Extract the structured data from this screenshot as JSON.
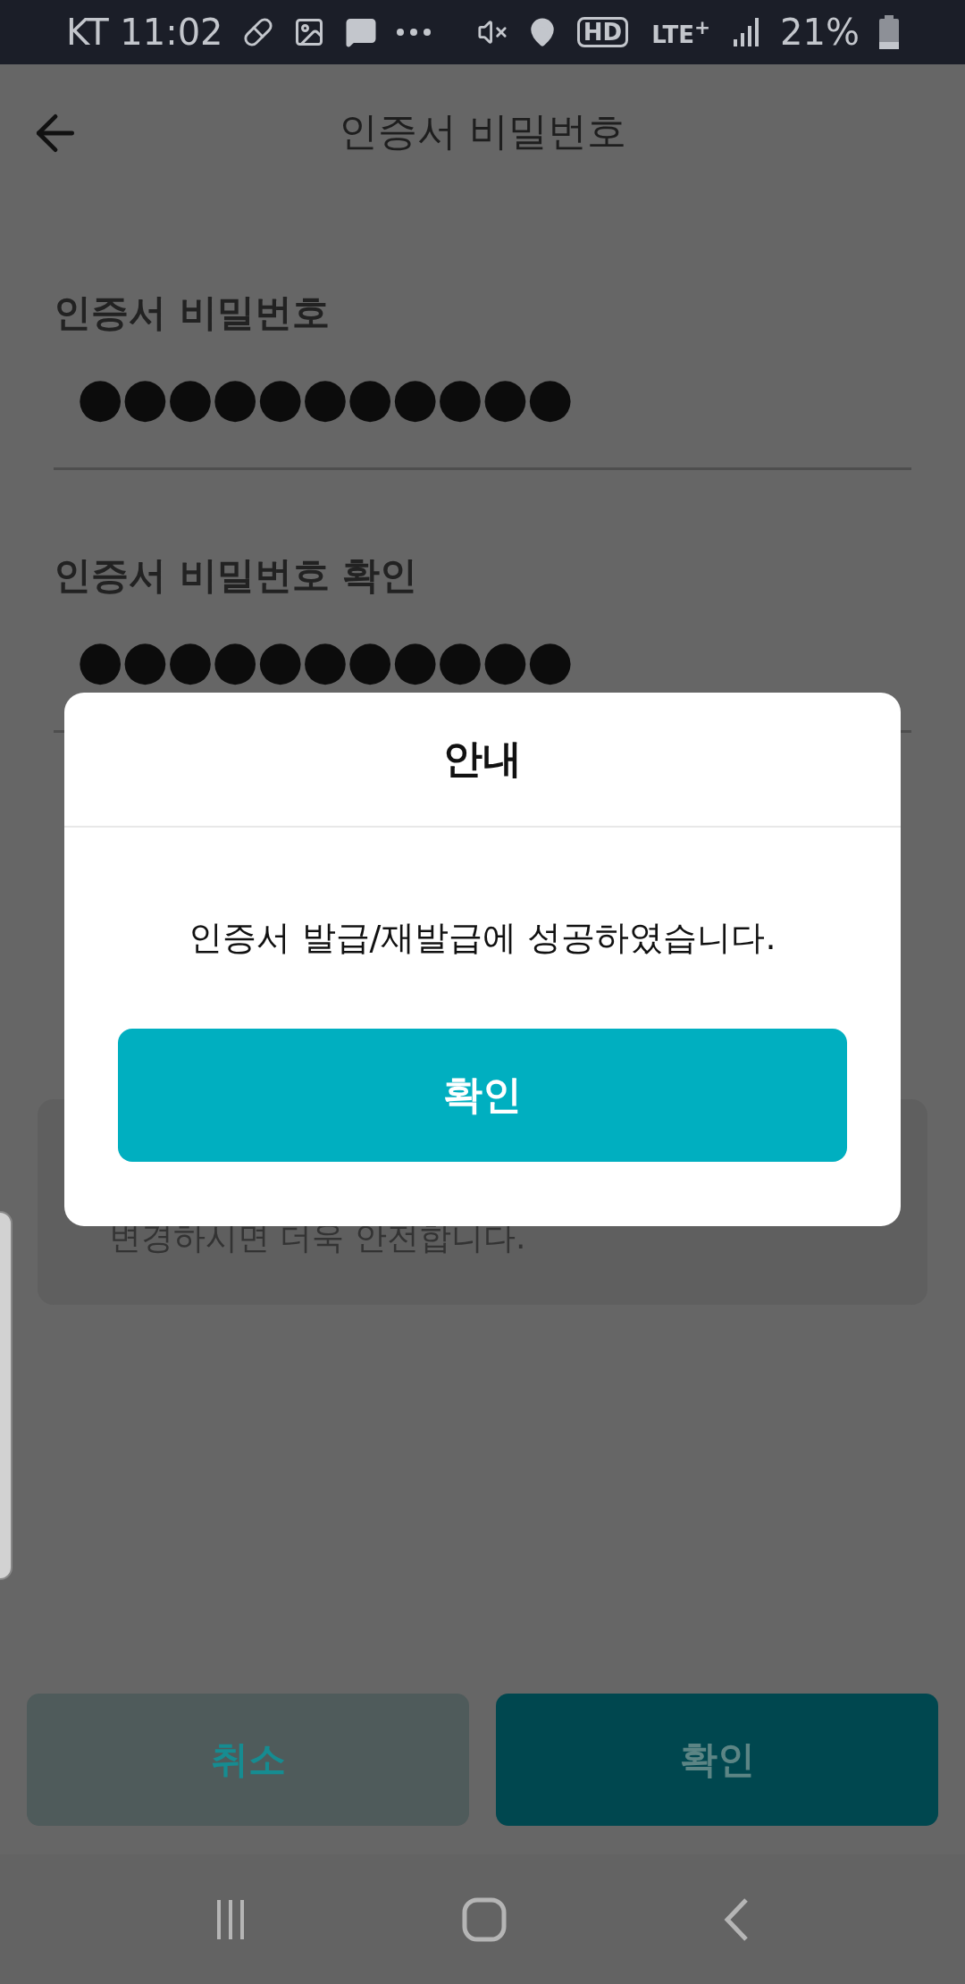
{
  "status_bar": {
    "carrier_time": "KT 11:02",
    "network_labels": [
      "HD",
      "LTE$^{+}$"
    ],
    "battery": "21%"
  },
  "app_bar": {
    "title": "인증서 비밀번호"
  },
  "fields": [
    {
      "label": "인증서 비밀번호",
      "value": "●●●●●●●●●●●"
    },
    {
      "label": "인증서 비밀번호 확인",
      "value": "●●●●●●●●●●●"
    }
  ],
  "notice": {
    "text": "변경하시면 더욱 안전합니다."
  },
  "bottom_buttons": [
    {
      "label": "취소",
      "kind": "secondary"
    },
    {
      "label": "확인",
      "kind": "primary"
    }
  ],
  "dialog": {
    "title": "안내",
    "message": "인증서 발급/재발급에 성공하였습니다.",
    "button": "확인"
  }
}
